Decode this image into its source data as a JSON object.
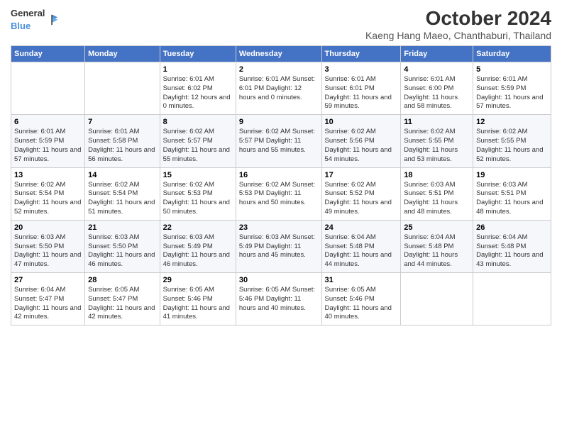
{
  "brand": {
    "name_general": "General",
    "name_blue": "Blue"
  },
  "title": "October 2024",
  "subtitle": "Kaeng Hang Maeo, Chanthaburi, Thailand",
  "days_of_week": [
    "Sunday",
    "Monday",
    "Tuesday",
    "Wednesday",
    "Thursday",
    "Friday",
    "Saturday"
  ],
  "weeks": [
    [
      {
        "day": "",
        "detail": ""
      },
      {
        "day": "",
        "detail": ""
      },
      {
        "day": "1",
        "detail": "Sunrise: 6:01 AM\nSunset: 6:02 PM\nDaylight: 12 hours\nand 0 minutes."
      },
      {
        "day": "2",
        "detail": "Sunrise: 6:01 AM\nSunset: 6:01 PM\nDaylight: 12 hours\nand 0 minutes."
      },
      {
        "day": "3",
        "detail": "Sunrise: 6:01 AM\nSunset: 6:01 PM\nDaylight: 11 hours\nand 59 minutes."
      },
      {
        "day": "4",
        "detail": "Sunrise: 6:01 AM\nSunset: 6:00 PM\nDaylight: 11 hours\nand 58 minutes."
      },
      {
        "day": "5",
        "detail": "Sunrise: 6:01 AM\nSunset: 5:59 PM\nDaylight: 11 hours\nand 57 minutes."
      }
    ],
    [
      {
        "day": "6",
        "detail": "Sunrise: 6:01 AM\nSunset: 5:59 PM\nDaylight: 11 hours\nand 57 minutes."
      },
      {
        "day": "7",
        "detail": "Sunrise: 6:01 AM\nSunset: 5:58 PM\nDaylight: 11 hours\nand 56 minutes."
      },
      {
        "day": "8",
        "detail": "Sunrise: 6:02 AM\nSunset: 5:57 PM\nDaylight: 11 hours\nand 55 minutes."
      },
      {
        "day": "9",
        "detail": "Sunrise: 6:02 AM\nSunset: 5:57 PM\nDaylight: 11 hours\nand 55 minutes."
      },
      {
        "day": "10",
        "detail": "Sunrise: 6:02 AM\nSunset: 5:56 PM\nDaylight: 11 hours\nand 54 minutes."
      },
      {
        "day": "11",
        "detail": "Sunrise: 6:02 AM\nSunset: 5:55 PM\nDaylight: 11 hours\nand 53 minutes."
      },
      {
        "day": "12",
        "detail": "Sunrise: 6:02 AM\nSunset: 5:55 PM\nDaylight: 11 hours\nand 52 minutes."
      }
    ],
    [
      {
        "day": "13",
        "detail": "Sunrise: 6:02 AM\nSunset: 5:54 PM\nDaylight: 11 hours\nand 52 minutes."
      },
      {
        "day": "14",
        "detail": "Sunrise: 6:02 AM\nSunset: 5:54 PM\nDaylight: 11 hours\nand 51 minutes."
      },
      {
        "day": "15",
        "detail": "Sunrise: 6:02 AM\nSunset: 5:53 PM\nDaylight: 11 hours\nand 50 minutes."
      },
      {
        "day": "16",
        "detail": "Sunrise: 6:02 AM\nSunset: 5:53 PM\nDaylight: 11 hours\nand 50 minutes."
      },
      {
        "day": "17",
        "detail": "Sunrise: 6:02 AM\nSunset: 5:52 PM\nDaylight: 11 hours\nand 49 minutes."
      },
      {
        "day": "18",
        "detail": "Sunrise: 6:03 AM\nSunset: 5:51 PM\nDaylight: 11 hours\nand 48 minutes."
      },
      {
        "day": "19",
        "detail": "Sunrise: 6:03 AM\nSunset: 5:51 PM\nDaylight: 11 hours\nand 48 minutes."
      }
    ],
    [
      {
        "day": "20",
        "detail": "Sunrise: 6:03 AM\nSunset: 5:50 PM\nDaylight: 11 hours\nand 47 minutes."
      },
      {
        "day": "21",
        "detail": "Sunrise: 6:03 AM\nSunset: 5:50 PM\nDaylight: 11 hours\nand 46 minutes."
      },
      {
        "day": "22",
        "detail": "Sunrise: 6:03 AM\nSunset: 5:49 PM\nDaylight: 11 hours\nand 46 minutes."
      },
      {
        "day": "23",
        "detail": "Sunrise: 6:03 AM\nSunset: 5:49 PM\nDaylight: 11 hours\nand 45 minutes."
      },
      {
        "day": "24",
        "detail": "Sunrise: 6:04 AM\nSunset: 5:48 PM\nDaylight: 11 hours\nand 44 minutes."
      },
      {
        "day": "25",
        "detail": "Sunrise: 6:04 AM\nSunset: 5:48 PM\nDaylight: 11 hours\nand 44 minutes."
      },
      {
        "day": "26",
        "detail": "Sunrise: 6:04 AM\nSunset: 5:48 PM\nDaylight: 11 hours\nand 43 minutes."
      }
    ],
    [
      {
        "day": "27",
        "detail": "Sunrise: 6:04 AM\nSunset: 5:47 PM\nDaylight: 11 hours\nand 42 minutes."
      },
      {
        "day": "28",
        "detail": "Sunrise: 6:05 AM\nSunset: 5:47 PM\nDaylight: 11 hours\nand 42 minutes."
      },
      {
        "day": "29",
        "detail": "Sunrise: 6:05 AM\nSunset: 5:46 PM\nDaylight: 11 hours\nand 41 minutes."
      },
      {
        "day": "30",
        "detail": "Sunrise: 6:05 AM\nSunset: 5:46 PM\nDaylight: 11 hours\nand 40 minutes."
      },
      {
        "day": "31",
        "detail": "Sunrise: 6:05 AM\nSunset: 5:46 PM\nDaylight: 11 hours\nand 40 minutes."
      },
      {
        "day": "",
        "detail": ""
      },
      {
        "day": "",
        "detail": ""
      }
    ]
  ]
}
